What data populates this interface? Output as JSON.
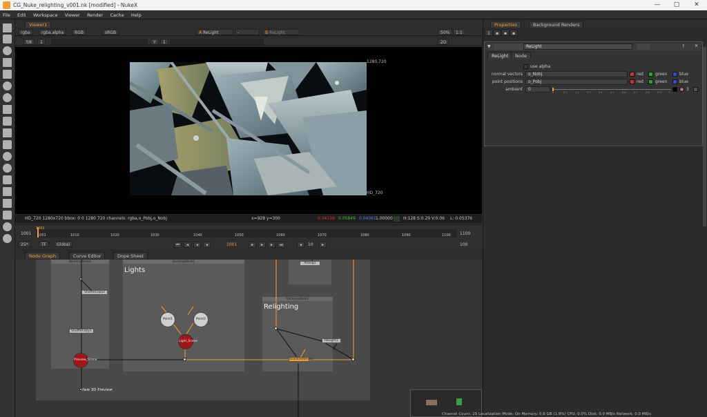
{
  "window": {
    "title": "CG_Nuke_relighting_v001.nk [modified] - NukeX",
    "controls": [
      "—",
      "▢",
      "✕"
    ]
  },
  "menu": [
    "File",
    "Edit",
    "Workspace",
    "Viewer",
    "Render",
    "Cache",
    "Help"
  ],
  "viewer_tab": "Viewer1",
  "viewer_controls": {
    "channels": "rgba",
    "alpha": "rgba.alpha",
    "colorspace": "RGB",
    "lut": "sRGB",
    "input_a_label": "A",
    "input_a": "ReLight",
    "dash": "-",
    "input_b_label": "B",
    "input_b": "ReLight",
    "zoom": "50%",
    "ratio": "1:1",
    "fstop": "f/8",
    "gain": "1",
    "gamma_label": "Y",
    "gamma": "1",
    "mode": "2D"
  },
  "viewer": {
    "format_corner_tr": "1280,720",
    "format_corner_br": "HD_720"
  },
  "infobar": {
    "format": "HD_720 1280x720  bbox: 0 0 1280 720 channels: rgba,o_Pobj,o_Nobj",
    "coords": "x=928 y=300",
    "r": "0.04139",
    "g": "0.05849",
    "b": "0.04361",
    "a": "1.00000",
    "hsv": "H:128 S:0.29 V:0.06",
    "lum": "L: 0.05376"
  },
  "timeline": {
    "ticks": [
      "1001",
      "1010",
      "1020",
      "1030",
      "1040",
      "1050",
      "1060",
      "1070",
      "1080",
      "1090",
      "1100"
    ],
    "start": "1001",
    "end": "1100",
    "current": "1001",
    "fps": "25*",
    "tf": "TF",
    "scope": "Global",
    "frame": "1001",
    "step": "10",
    "end_field": "100"
  },
  "nodegraph_tabs": [
    "Node Graph",
    "Curve Editor",
    "Dope Sheet"
  ],
  "nodes": {
    "backdrop1_title": "BackdropNode1",
    "backdrop2_title": "BackdropNode2",
    "backdrop3_title": "BackdropNode3",
    "lights_label": "Lights",
    "relighting_label": "Relighting",
    "shuffle1": "ShuffleCopy1",
    "shuffle2": "ShuffleCopy2",
    "point1": "Point1",
    "point2": "Point2",
    "light_scene": "Light_Scene",
    "preview_scene": "Preview_Scene",
    "view_3d": "View 3D Preview",
    "relight1": "ReLight1",
    "shader": "Phong1",
    "render": "ScanlineRender"
  },
  "properties": {
    "tabs": [
      "Properties",
      "Background Renders"
    ],
    "node_name": "ReLight",
    "subtabs": [
      "ReLight",
      "Node"
    ],
    "use_alpha": "use alpha",
    "normal_vectors_label": "normal vectors",
    "normal_vectors": "o_Nobj",
    "point_positions_label": "point positions",
    "point_positions": "o_Pobj",
    "red": "red",
    "green": "green",
    "blue": "blue",
    "ambient_label": "ambient",
    "ambient": "0",
    "ambient_ticks": [
      "0",
      "0.1",
      "0.2",
      "0.3",
      "0.4",
      "0.5",
      "0.6",
      "0.7",
      "0.8",
      "0.9",
      "1"
    ],
    "ambient_extra": "3"
  },
  "status": "Channel Count: 25  Localization Mode: On  Memory: 0.6 GB (1.9%)  CPU: 0.0%  Disk: 0.0 MB/s  Network: 0.0 MB/s",
  "colors": {
    "accent": "#f0a030",
    "red_node": "#a0161a",
    "backdrop": "#5a5a5a"
  }
}
